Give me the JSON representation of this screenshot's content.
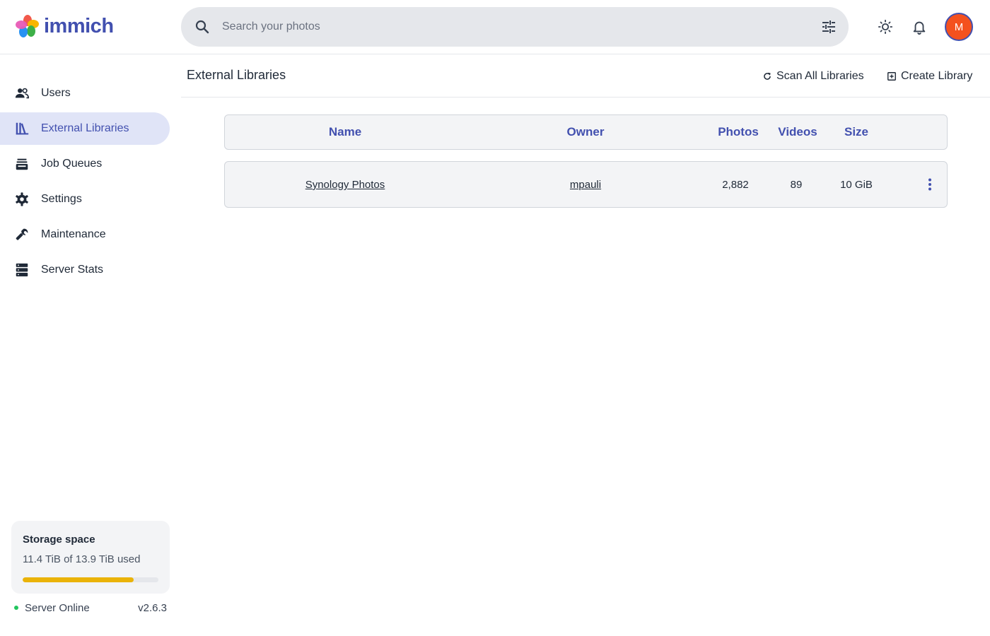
{
  "app": {
    "name": "immich",
    "brand_color": "#4250af"
  },
  "header": {
    "search": {
      "placeholder": "Search your photos",
      "value": ""
    },
    "icons": [
      "search-icon",
      "tune-icon",
      "theme-toggle-icon",
      "bell-icon"
    ],
    "avatar_initial": "M",
    "avatar_color": "#f4511e"
  },
  "sidebar": {
    "items": [
      {
        "label": "Users",
        "icon": "users-icon",
        "active": false
      },
      {
        "label": "External Libraries",
        "icon": "library-books-icon",
        "active": true
      },
      {
        "label": "Job Queues",
        "icon": "tray-stack-icon",
        "active": false
      },
      {
        "label": "Settings",
        "icon": "gear-icon",
        "active": false
      },
      {
        "label": "Maintenance",
        "icon": "wrench-icon",
        "active": false
      },
      {
        "label": "Server Stats",
        "icon": "server-icon",
        "active": false
      }
    ],
    "storage": {
      "title": "Storage space",
      "used_text": "11.4 TiB of 13.9 TiB used",
      "used_fraction": 0.82,
      "bar_color": "#eab308"
    },
    "status": {
      "text": "Server Online",
      "color": "#22c55e",
      "version": "v2.6.3"
    }
  },
  "main": {
    "title": "External Libraries",
    "actions": {
      "scan_label": "Scan All Libraries",
      "create_label": "Create Library"
    },
    "table": {
      "columns": [
        "Name",
        "Owner",
        "Photos",
        "Videos",
        "Size"
      ],
      "rows": [
        {
          "name": "Synology Photos",
          "owner": "mpauli",
          "photos": "2,882",
          "videos": "89",
          "size": "10 GiB"
        }
      ]
    }
  }
}
